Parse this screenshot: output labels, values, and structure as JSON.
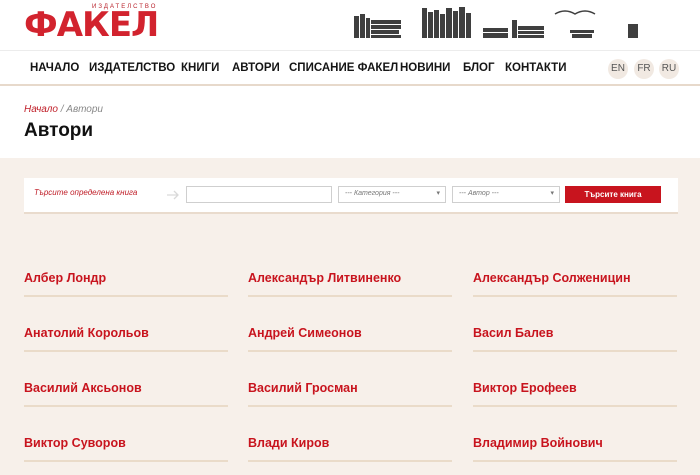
{
  "brand": {
    "subtitle": "ИЗДАТЕЛСТВО",
    "name": "ФАКЕЛ",
    "color": "#d2232e"
  },
  "nav": {
    "items": [
      "НАЧАЛО",
      "ИЗДАТЕЛСТВО",
      "КНИГИ",
      "АВТОРИ",
      "СПИСАНИЕ ФАКЕЛ",
      "НОВИНИ",
      "БЛОГ",
      "КОНТАКТИ"
    ],
    "languages": [
      "EN",
      "FR",
      "RU"
    ]
  },
  "breadcrumb": {
    "home": "Начало",
    "separator": " / ",
    "current": "Автори"
  },
  "page_title": "Автори",
  "search": {
    "label": "Търсите определена книга",
    "input_value": "",
    "category_placeholder": "--- Категория ---",
    "author_placeholder": "--- Автор ---",
    "button_label": "Търсите книга"
  },
  "authors": [
    "Албер Лондр",
    "Александър Литвиненко",
    "Александър Солженицин",
    "Анатолий Корольов",
    "Андрей Симеонов",
    "Васил Балев",
    "Василий Аксьонов",
    "Василий Гросман",
    "Виктор Ерофеев",
    "Виктор Суворов",
    "Влади Киров",
    "Владимир Войнович"
  ],
  "colors": {
    "accent": "#c8141e",
    "background": "#f7f0ea",
    "underline": "#eadbc9"
  }
}
